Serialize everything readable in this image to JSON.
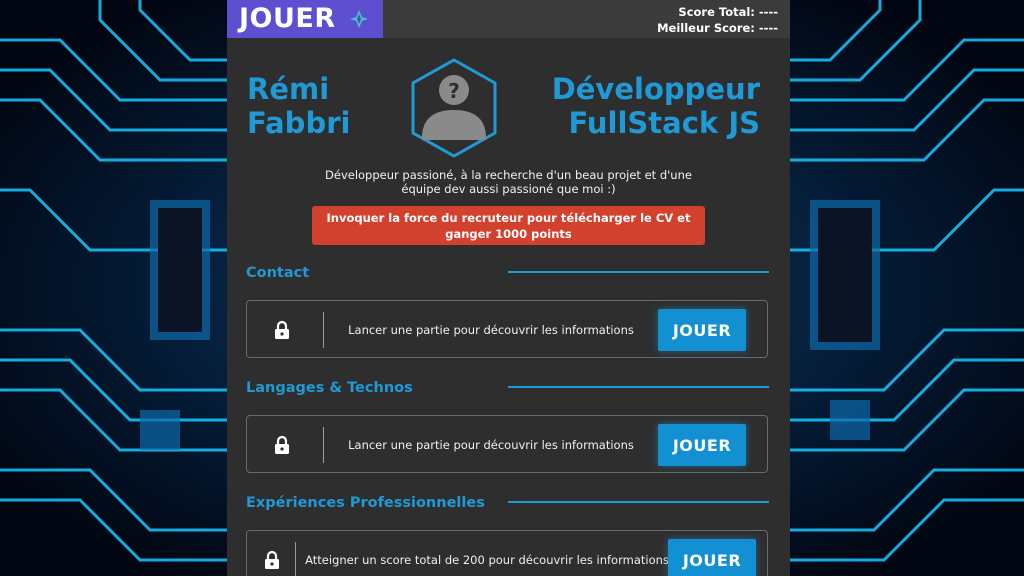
{
  "topbar": {
    "play_label": "JOUER",
    "score_total": "Score Total: ----",
    "best_score": "Meilleur Score: ----"
  },
  "profile": {
    "first_name": "Rémi",
    "last_name": "Fabbri",
    "role_line1": "Développeur",
    "role_line2": "FullStack JS",
    "description": "Développeur passioné, à la recherche d'un beau projet et d'une équipe dev aussi passioné que moi :)",
    "cv_button": "Invoquer la force du recruteur pour télécharger le CV et ganger 1000 points"
  },
  "sections": [
    {
      "title": "Contact",
      "message": "Lancer une partie pour découvrir les informations",
      "button": "JOUER"
    },
    {
      "title": "Langages & Technos",
      "message": "Lancer une partie pour découvrir les informations",
      "button": "JOUER"
    },
    {
      "title": "Expériences Professionnelles",
      "message": "Atteigner un score total de 200 pour découvrir les informations",
      "button": "JOUER"
    }
  ],
  "colors": {
    "accent_blue": "#1f9ad6",
    "play_tab_purple": "#5d4fcf",
    "cv_button_red": "#d2402e",
    "panel_bg": "#2e2e2e"
  },
  "icons": {
    "ship": "spaceship-icon",
    "avatar": "unknown-user-hexagon-icon",
    "lock": "lock-icon"
  }
}
